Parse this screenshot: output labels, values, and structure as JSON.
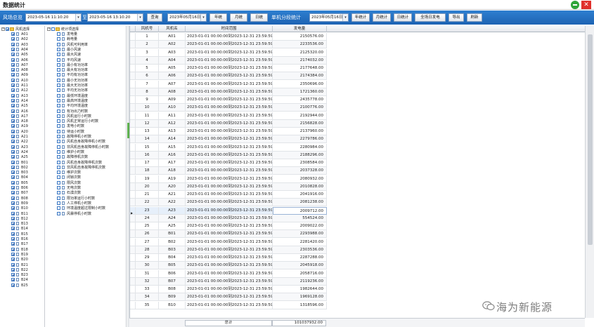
{
  "window": {
    "title": "数据统计"
  },
  "toolbar": {
    "range_label": "风场总览",
    "start_time": "2023-05-16 11:10:20",
    "to_label": "至",
    "end_time": "2023-05-16 13:10:20",
    "query_btn": "查询",
    "date1": "2023年05月16日",
    "year_btn": "年统",
    "month_btn": "月统",
    "day_btn": "日统",
    "stats_label": "单机分段统计",
    "date2": "2023年05月16日",
    "year_stat_btn": "年统计",
    "month_stat_btn": "月统计",
    "day_stat_btn": "日统计",
    "full_gen_btn": "全场日发电",
    "export_btn": "导出",
    "refresh_btn": "刷新"
  },
  "turbine_tree": {
    "root_label": "风机选择",
    "items": [
      "A01",
      "A02",
      "A03",
      "A04",
      "A05",
      "A06",
      "A07",
      "A08",
      "A09",
      "A10",
      "A11",
      "A12",
      "A13",
      "A14",
      "A15",
      "A16",
      "A17",
      "A18",
      "A19",
      "A20",
      "A21",
      "A22",
      "A23",
      "A24",
      "A25",
      "B01",
      "B02",
      "B03",
      "B04",
      "B05",
      "B06",
      "B07",
      "B08",
      "B09",
      "B10",
      "B11",
      "B12",
      "B13",
      "B14",
      "B15",
      "B16",
      "B17",
      "B18",
      "B19",
      "B20",
      "B21",
      "B22",
      "B23",
      "B24",
      "B25"
    ]
  },
  "metric_tree": {
    "root_label": "统计项选择",
    "items": [
      "发电量",
      "耗电量",
      "风机可利用率",
      "最小风速",
      "最大风速",
      "平均风速",
      "最小有功功率",
      "最大有功功率",
      "平均有功功率",
      "最小无功功率",
      "最大无功功率",
      "平均无功功率",
      "最低环境温度",
      "最高环境温度",
      "平均环境温度",
      "有功出力时数",
      "风机运行小时数",
      "风机正常运行小时数",
      "发电小时数",
      "待运小时数",
      "故障停机小时数",
      "风机自身故障停机小时数",
      "非风机自身故障停机小时数",
      "维护小时数",
      "故障停机次数",
      "风机自身故障停机次数",
      "非风机自身故障停机次数",
      "维护次数",
      "闭锁次数",
      "限风次数",
      "无电次数",
      "石漠次数",
      "限功率运行小时数",
      "人工停机小时数",
      "环境温度超过限制小时数",
      "风暴停机小时数"
    ]
  },
  "grid": {
    "columns": [
      "风机号",
      "风机名",
      "时间范围",
      "发电量"
    ],
    "time_range": "2023-01-01 00:00:00到2023-12-31 23:59:59",
    "rows": [
      {
        "no": "1",
        "name": "A01",
        "value": "2150576.00"
      },
      {
        "no": "2",
        "name": "A02",
        "value": "2233536.00"
      },
      {
        "no": "3",
        "name": "A03",
        "value": "2125320.00"
      },
      {
        "no": "4",
        "name": "A04",
        "value": "2174032.00"
      },
      {
        "no": "5",
        "name": "A05",
        "value": "2177648.00"
      },
      {
        "no": "6",
        "name": "A06",
        "value": "2174384.00"
      },
      {
        "no": "7",
        "name": "A07",
        "value": "2350696.00"
      },
      {
        "no": "8",
        "name": "A08",
        "value": "1721360.00"
      },
      {
        "no": "9",
        "name": "A09",
        "value": "2435778.00"
      },
      {
        "no": "10",
        "name": "A10",
        "value": "2100776.00"
      },
      {
        "no": "11",
        "name": "A11",
        "value": "2192944.00"
      },
      {
        "no": "12",
        "name": "A12",
        "value": "2156828.00"
      },
      {
        "no": "13",
        "name": "A13",
        "value": "2137960.00"
      },
      {
        "no": "14",
        "name": "A14",
        "value": "2279786.00"
      },
      {
        "no": "15",
        "name": "A15",
        "value": "2280984.00"
      },
      {
        "no": "16",
        "name": "A16",
        "value": "2188296.00"
      },
      {
        "no": "17",
        "name": "A17",
        "value": "2308584.00"
      },
      {
        "no": "18",
        "name": "A18",
        "value": "2037328.00"
      },
      {
        "no": "19",
        "name": "A19",
        "value": "2080932.00"
      },
      {
        "no": "20",
        "name": "A20",
        "value": "2010828.00"
      },
      {
        "no": "21",
        "name": "A21",
        "value": "2041916.00"
      },
      {
        "no": "22",
        "name": "A22",
        "value": "2081238.00"
      },
      {
        "no": "23",
        "name": "A23",
        "value": "2009712.00"
      },
      {
        "no": "24",
        "name": "A24",
        "value": "554524.00"
      },
      {
        "no": "25",
        "name": "A25",
        "value": "2009022.00"
      },
      {
        "no": "26",
        "name": "B01",
        "value": "2293988.00"
      },
      {
        "no": "27",
        "name": "B02",
        "value": "2281420.00"
      },
      {
        "no": "28",
        "name": "B03",
        "value": "2303536.00"
      },
      {
        "no": "29",
        "name": "B04",
        "value": "2287288.00"
      },
      {
        "no": "30",
        "name": "B05",
        "value": "2045918.00"
      },
      {
        "no": "31",
        "name": "B06",
        "value": "2058716.00"
      },
      {
        "no": "32",
        "name": "B07",
        "value": "2119236.00"
      },
      {
        "no": "33",
        "name": "B08",
        "value": "1982644.00"
      },
      {
        "no": "34",
        "name": "B09",
        "value": "1969128.00"
      },
      {
        "no": "35",
        "name": "B10",
        "value": "1318596.00"
      }
    ],
    "selected_row": 22
  },
  "footer": {
    "total_label": "总计",
    "total_value": "101037932.00"
  },
  "watermark": {
    "text": "海为新能源"
  }
}
